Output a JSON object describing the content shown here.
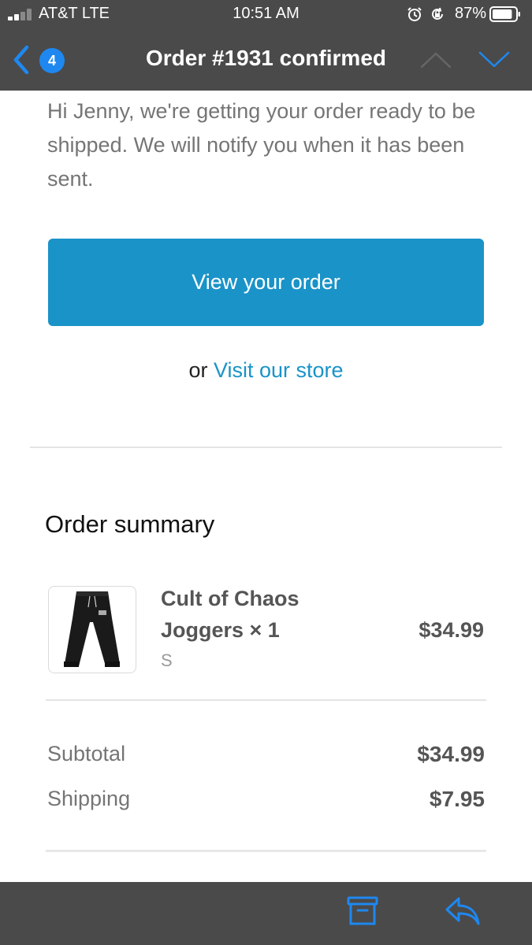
{
  "status_bar": {
    "carrier": "AT&T LTE",
    "time": "10:51 AM",
    "battery_percent": "87%",
    "battery_level": 0.87,
    "icons": [
      "alarm-icon",
      "rotation-lock-icon"
    ]
  },
  "nav": {
    "back_count": "4",
    "title": "Order #1931 confirmed",
    "icons": [
      "back-chevron-icon",
      "chevron-up-icon",
      "chevron-down-icon"
    ]
  },
  "email": {
    "intro": "Hi Jenny, we're getting your order ready to be shipped. We will notify you when it has been sent.",
    "cta_label": "View your order",
    "alt_prefix": "or",
    "alt_link": "Visit our store",
    "summary_title": "Order summary",
    "item": {
      "name": "Cult of Chaos Joggers × 1",
      "variant": "S",
      "price": "$34.99",
      "image_icon": "joggers-product-image"
    },
    "totals": [
      {
        "label": "Subtotal",
        "value": "$34.99"
      },
      {
        "label": "Shipping",
        "value": "$7.95"
      }
    ]
  },
  "toolbar": {
    "icons": [
      "archive-icon",
      "reply-icon"
    ]
  },
  "colors": {
    "header_bg": "#4a4a4a",
    "accent_blue": "#1e88f0",
    "button_blue": "#1a93c8",
    "text_gray": "#757575"
  }
}
